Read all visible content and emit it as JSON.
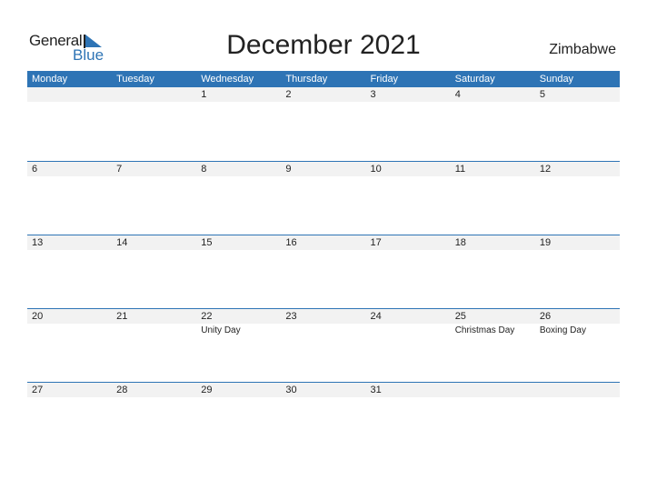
{
  "logo": {
    "general": "General",
    "blue": "Blue"
  },
  "title": "December 2021",
  "country": "Zimbabwe",
  "colors": {
    "accent": "#2e74b5",
    "strip": "#f2f2f2"
  },
  "weekdays": [
    "Monday",
    "Tuesday",
    "Wednesday",
    "Thursday",
    "Friday",
    "Saturday",
    "Sunday"
  ],
  "weeks": [
    {
      "days": [
        {
          "num": "",
          "holiday": ""
        },
        {
          "num": "",
          "holiday": ""
        },
        {
          "num": "1",
          "holiday": ""
        },
        {
          "num": "2",
          "holiday": ""
        },
        {
          "num": "3",
          "holiday": ""
        },
        {
          "num": "4",
          "holiday": ""
        },
        {
          "num": "5",
          "holiday": ""
        }
      ]
    },
    {
      "days": [
        {
          "num": "6",
          "holiday": ""
        },
        {
          "num": "7",
          "holiday": ""
        },
        {
          "num": "8",
          "holiday": ""
        },
        {
          "num": "9",
          "holiday": ""
        },
        {
          "num": "10",
          "holiday": ""
        },
        {
          "num": "11",
          "holiday": ""
        },
        {
          "num": "12",
          "holiday": ""
        }
      ]
    },
    {
      "days": [
        {
          "num": "13",
          "holiday": ""
        },
        {
          "num": "14",
          "holiday": ""
        },
        {
          "num": "15",
          "holiday": ""
        },
        {
          "num": "16",
          "holiday": ""
        },
        {
          "num": "17",
          "holiday": ""
        },
        {
          "num": "18",
          "holiday": ""
        },
        {
          "num": "19",
          "holiday": ""
        }
      ]
    },
    {
      "days": [
        {
          "num": "20",
          "holiday": ""
        },
        {
          "num": "21",
          "holiday": ""
        },
        {
          "num": "22",
          "holiday": "Unity Day"
        },
        {
          "num": "23",
          "holiday": ""
        },
        {
          "num": "24",
          "holiday": ""
        },
        {
          "num": "25",
          "holiday": "Christmas Day"
        },
        {
          "num": "26",
          "holiday": "Boxing Day"
        }
      ]
    },
    {
      "days": [
        {
          "num": "27",
          "holiday": ""
        },
        {
          "num": "28",
          "holiday": ""
        },
        {
          "num": "29",
          "holiday": ""
        },
        {
          "num": "30",
          "holiday": ""
        },
        {
          "num": "31",
          "holiday": ""
        },
        {
          "num": "",
          "holiday": ""
        },
        {
          "num": "",
          "holiday": ""
        }
      ]
    }
  ]
}
